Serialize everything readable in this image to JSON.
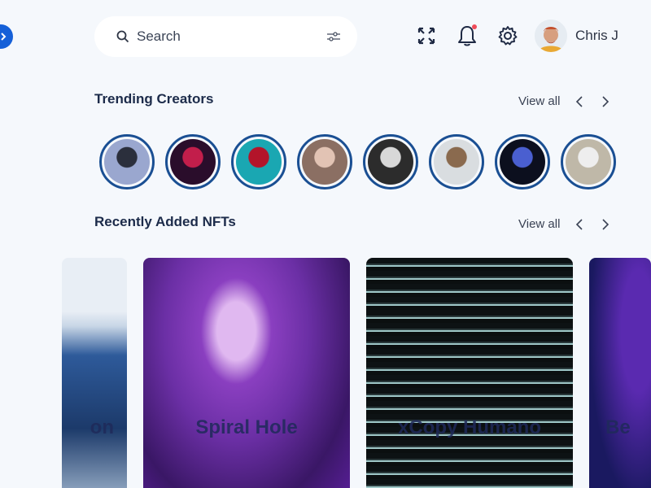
{
  "header": {
    "search": {
      "placeholder": "Search",
      "icon": "search-icon",
      "filter_icon": "filter-sliders-icon"
    },
    "actions": [
      {
        "name": "fullscreen-icon"
      },
      {
        "name": "bell-icon",
        "has_notification": true
      },
      {
        "name": "gear-icon"
      }
    ],
    "user": {
      "name": "Chris J"
    }
  },
  "trending": {
    "title": "Trending Creators",
    "view_all": "View all",
    "creators": [
      {
        "colors": [
          "#9aa7cf",
          "#2b2f3c"
        ]
      },
      {
        "colors": [
          "#2a0d2b",
          "#c21e4b"
        ]
      },
      {
        "colors": [
          "#1aa7b2",
          "#b3142a"
        ]
      },
      {
        "colors": [
          "#8b6f63",
          "#e2c3b4"
        ]
      },
      {
        "colors": [
          "#2c2c2c",
          "#d8d8d8"
        ]
      },
      {
        "colors": [
          "#d9dde0",
          "#8a6a4e"
        ]
      },
      {
        "colors": [
          "#0c0f1e",
          "#4a5fd0"
        ]
      },
      {
        "colors": [
          "#bfb8a8",
          "#eeeeee"
        ]
      }
    ]
  },
  "recent": {
    "title": "Recently Added NFTs",
    "view_all": "View all",
    "cards": [
      {
        "title": "on",
        "colors": [
          "#e8eef5",
          "#2e5a9a"
        ]
      },
      {
        "title": "Spiral Hole",
        "colors": [
          "#6b2fa5",
          "#e0b8f0"
        ]
      },
      {
        "title": "xCopy Humano",
        "colors": [
          "#0d1214",
          "#9fc8c8"
        ]
      },
      {
        "title": "Be",
        "colors": [
          "#1a1960",
          "#5a2ab0"
        ]
      }
    ]
  },
  "accent": "#1560d8"
}
